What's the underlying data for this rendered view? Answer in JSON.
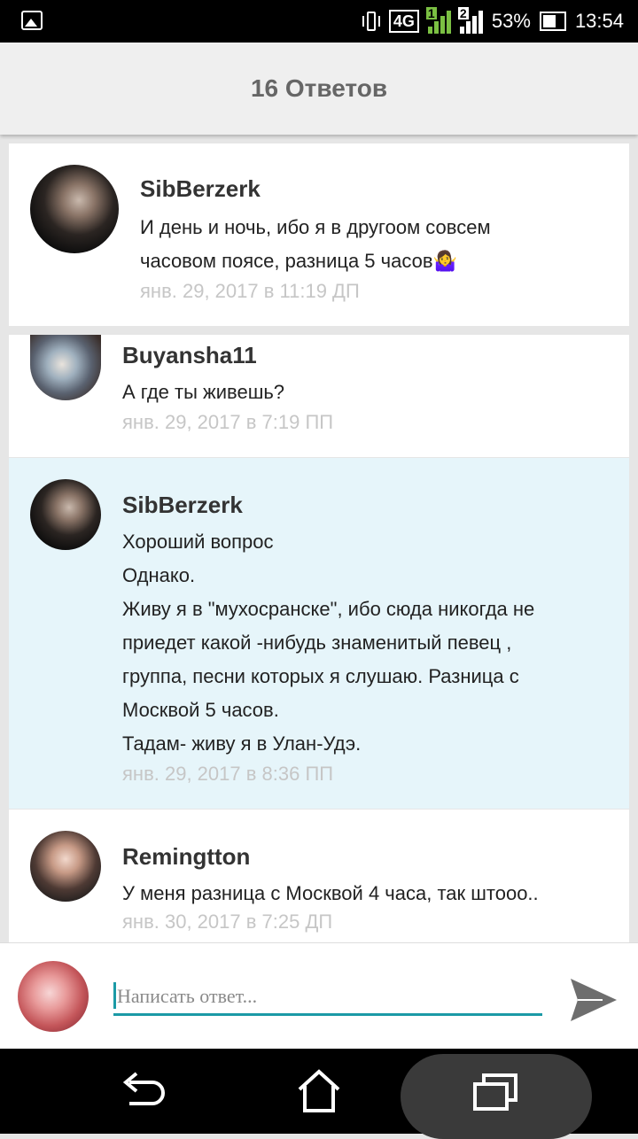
{
  "status_bar": {
    "network": "4G",
    "sim1": "1",
    "sim2": "2",
    "battery": "53%",
    "time": "13:54"
  },
  "header": {
    "title": "16 Ответов"
  },
  "comments": [
    {
      "author": "SibBerzerk",
      "text": "И день и ночь, ибо я в другоом совсем\nчасовом поясе, разница 5 часов🤷‍♀️",
      "date": "янв. 29, 2017 в 11:19 ДП"
    },
    {
      "author": "Buyansha11",
      "text": "А где ты живешь?",
      "date": "янв. 29, 2017 в 7:19 ПП"
    },
    {
      "author": "SibBerzerk",
      "text": "Хороший вопрос\nОднако.\nЖиву я в \"мухосранске\", ибо сюда никогда не\nприедет какой -нибудь знаменитый певец ,\nгруппа, песни которых я слушаю. Разница с\nМосквой 5 часов.\nТадам- живу я в Улан-Удэ.",
      "date": "янв. 29, 2017 в 8:36 ПП"
    },
    {
      "author": "Remingtton",
      "text": "У меня разница с Москвой 4 часа, так штооо..",
      "date": "янв. 30, 2017 в 7:25 ДП"
    }
  ],
  "composer": {
    "placeholder": "Написать ответ..."
  },
  "colors": {
    "accent": "#1b9aa6",
    "highlight": "#e6f5fa"
  }
}
